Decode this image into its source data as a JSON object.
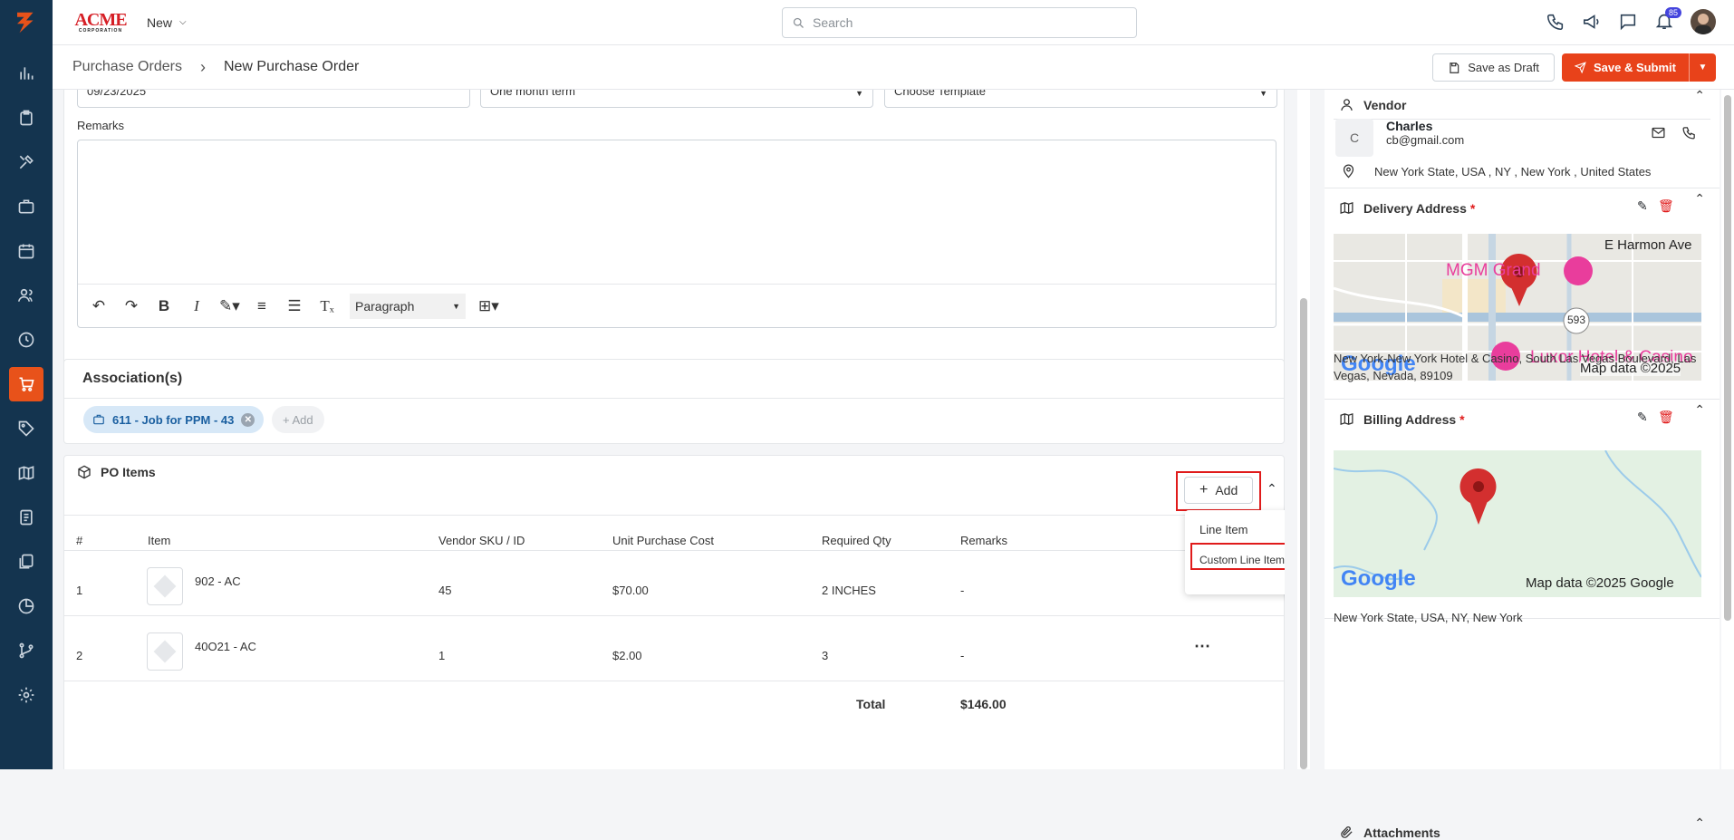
{
  "header": {
    "logo_top": "ACME",
    "logo_bottom": "CORPORATION",
    "new_label": "New",
    "search_placeholder": "Search",
    "notif_count": "85"
  },
  "subheader": {
    "breadcrumb_root": "Purchase Orders",
    "breadcrumb_current": "New Purchase Order",
    "draft_label": "Save as Draft",
    "submit_label": "Save & Submit"
  },
  "form": {
    "date_value": "09/23/2025",
    "term_value": "One month term",
    "template_value": "Choose Template",
    "remarks_label": "Remarks",
    "paragraph_label": "Paragraph"
  },
  "associations": {
    "title": "Association(s)",
    "chip_label": "611 - Job for PPM - 43",
    "add_label": "+ Add"
  },
  "po_items": {
    "title": "PO Items",
    "add_label": "Add",
    "columns": [
      "#",
      "Item",
      "Vendor SKU / ID",
      "Unit Purchase Cost",
      "Required Qty",
      "Remarks"
    ],
    "rows": [
      {
        "num": "1",
        "item": "902 - AC",
        "sku": "45",
        "cost": "$70.00",
        "qty": "2 INCHES",
        "remarks": "-"
      },
      {
        "num": "2",
        "item": "40O21 - AC",
        "sku": "1",
        "cost": "$2.00",
        "qty": "3",
        "remarks": "-"
      }
    ],
    "total_label": "Total",
    "total_value": "$146.00",
    "menu": [
      "Line Item",
      "Custom Line Item"
    ]
  },
  "vendor": {
    "title": "Vendor",
    "initial": "C",
    "name": "Charles",
    "email": "cb@gmail.com",
    "location": "New York State, USA , NY , New York , United States"
  },
  "delivery": {
    "title": "Delivery Address",
    "req": "*",
    "map_label1": "E Harmon Ave",
    "map_label2": "MGM Grand",
    "map_label3": "Luxor Hotel & Casino",
    "map_road": "593",
    "google": "Google",
    "map_credit": "Map data ©2025",
    "address": "New York-New York Hotel & Casino, South Las Vegas Boulevard, Las Vegas, Nevada, 89109"
  },
  "billing": {
    "title": "Billing Address",
    "req": "*",
    "google": "Google",
    "map_credit": "Map data ©2025 Google",
    "address": "New York State, USA, NY, New York"
  },
  "attachments": {
    "title": "Attachments"
  },
  "colors": {
    "sidebar": "#14344f",
    "accent": "#e8421a",
    "highlight": "#e01b1b",
    "chip": "#d7e8f7"
  }
}
